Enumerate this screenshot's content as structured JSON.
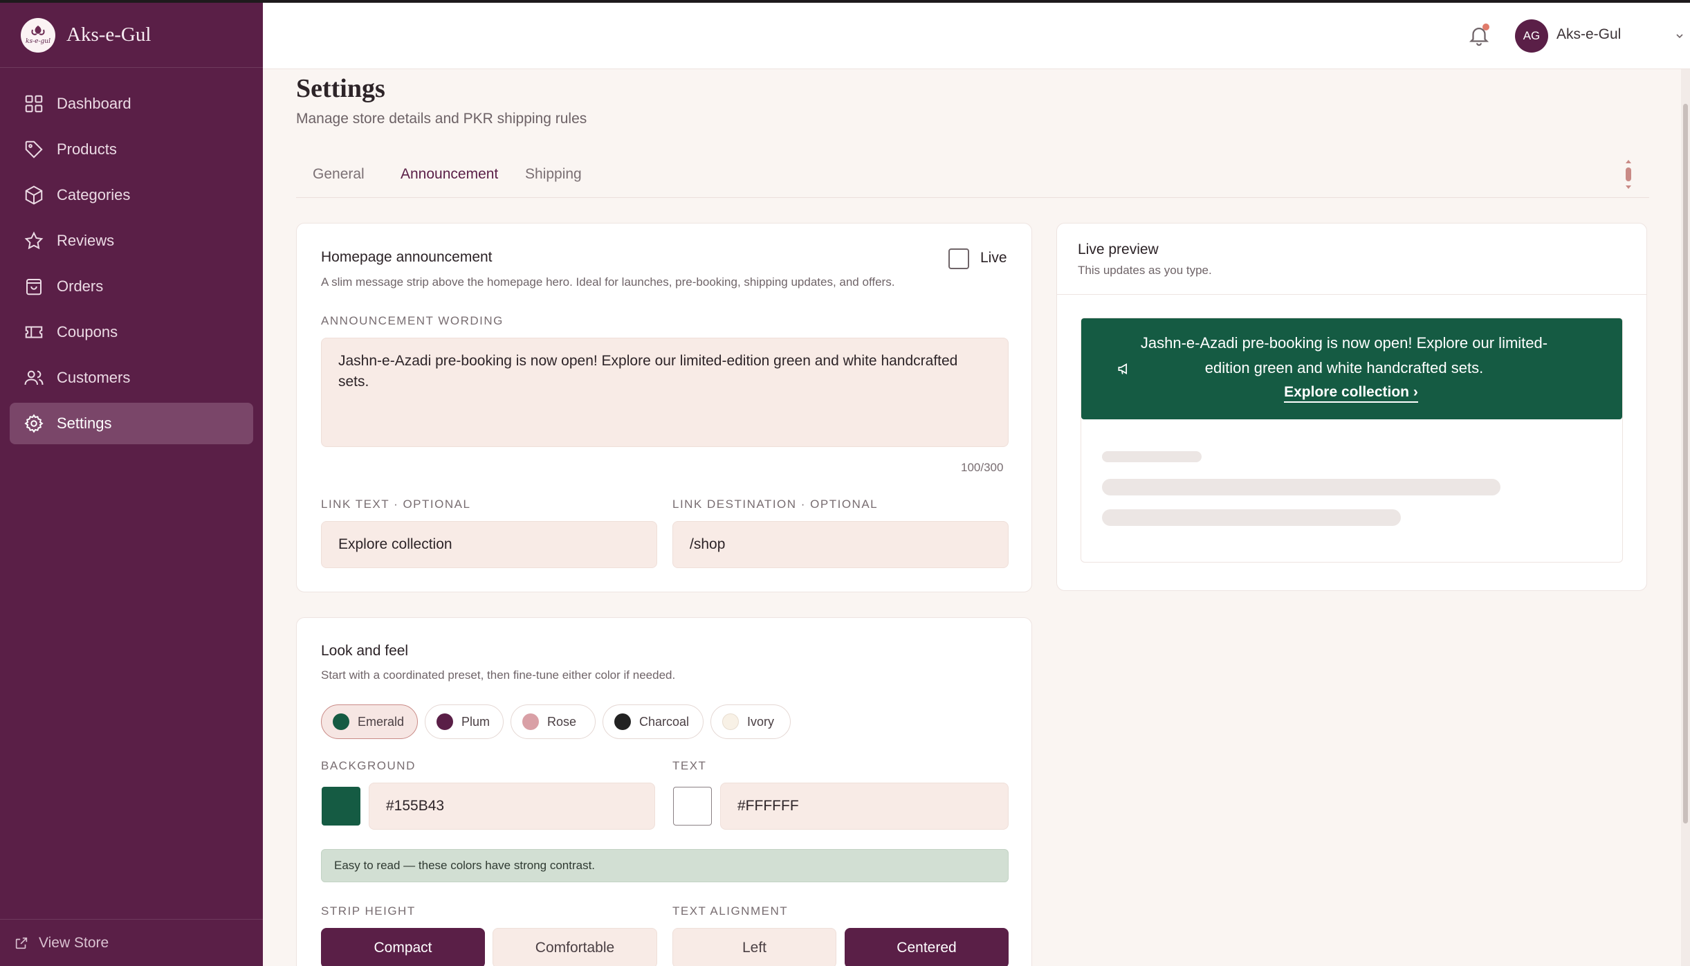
{
  "brand": {
    "name": "Aks-e-Gul",
    "logo_text": "Aks-e-Gul"
  },
  "sidebar": {
    "items": [
      {
        "label": "Dashboard",
        "icon": "grid-icon"
      },
      {
        "label": "Products",
        "icon": "tag-icon"
      },
      {
        "label": "Categories",
        "icon": "box-icon"
      },
      {
        "label": "Reviews",
        "icon": "star-icon"
      },
      {
        "label": "Orders",
        "icon": "bag-icon"
      },
      {
        "label": "Coupons",
        "icon": "ticket-icon"
      },
      {
        "label": "Customers",
        "icon": "users-icon"
      },
      {
        "label": "Settings",
        "icon": "gear-icon",
        "active": true
      }
    ],
    "view_store": "View Store"
  },
  "header": {
    "avatar_initials": "AG",
    "user_name": "Aks-e-Gul"
  },
  "page": {
    "title": "Settings",
    "subtitle": "Manage store details and PKR shipping rules"
  },
  "tabs": [
    {
      "label": "General"
    },
    {
      "label": "Announcement",
      "active": true
    },
    {
      "label": "Shipping"
    }
  ],
  "announcement": {
    "title": "Homepage announcement",
    "description": "A slim message strip above the homepage hero. Ideal for launches, pre-booking, shipping updates, and offers.",
    "live_label": "Live",
    "live_checked": false,
    "wording_label": "Announcement wording",
    "wording_value": "Jashn-e-Azadi pre-booking is now open! Explore our limited-edition green and white handcrafted sets.",
    "counter": "100/300",
    "link_text_label": "Link text · optional",
    "link_text_value": "Explore collection",
    "link_dest_label": "Link destination · optional",
    "link_dest_value": "/shop"
  },
  "look": {
    "title": "Look and feel",
    "description": "Start with a coordinated preset, then fine-tune either color if needed.",
    "presets": [
      {
        "label": "Emerald",
        "color": "#155B43",
        "active": true
      },
      {
        "label": "Plum",
        "color": "#5A1F47"
      },
      {
        "label": "Rose",
        "color": "#D9A0A6"
      },
      {
        "label": "Charcoal",
        "color": "#222222"
      },
      {
        "label": "Ivory",
        "color": "#F8F1E6"
      }
    ],
    "background_label": "Background",
    "background_value": "#155B43",
    "text_label": "Text",
    "text_value": "#FFFFFF",
    "contrast_note": "Easy to read — these colors have strong contrast.",
    "strip_height_label": "Strip height",
    "strip_height_options": [
      "Compact",
      "Comfortable"
    ],
    "strip_height_selected": "Compact",
    "alignment_label": "Text alignment",
    "alignment_options": [
      "Left",
      "Centered"
    ],
    "alignment_selected": "Centered"
  },
  "preview": {
    "title": "Live preview",
    "subtitle": "This updates as you type.",
    "strip_text": "Jashn-e-Azadi pre-booking is now open! Explore our limited-edition green and white handcrafted sets.",
    "strip_link": "Explore collection",
    "strip_link_arrow": "›",
    "strip_bg": "#155B43",
    "strip_fg": "#FFFFFF"
  }
}
